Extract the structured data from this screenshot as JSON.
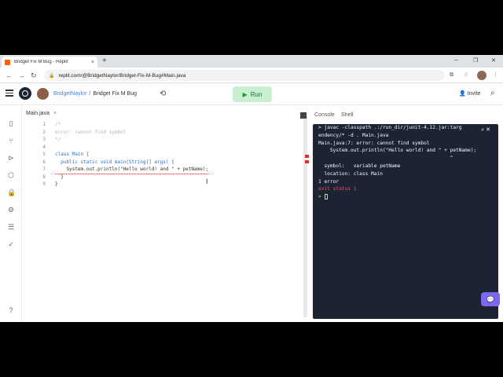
{
  "browser": {
    "tab_title": "Bridget Fix M Bug - Replit",
    "tab_close": "×",
    "new_tab": "+",
    "url": "replit.com/@BridgetNaylor/Bridget-Fix-M-Bug#Main.java",
    "win_minimize": "─",
    "win_restore": "❐",
    "win_close": "✕"
  },
  "header": {
    "user": "BridgetNaylor",
    "separator": "/",
    "repl_name": "Bridget Fix M Bug",
    "run_label": "Run",
    "invite_label": "Invite"
  },
  "editor": {
    "file_tab": "Main.java",
    "file_close": "×",
    "lines": [
      {
        "n": "1",
        "t": "/*"
      },
      {
        "n": "2",
        "t": "error: cannot find symbol"
      },
      {
        "n": "3",
        "t": "*/"
      },
      {
        "n": "4",
        "t": ""
      },
      {
        "n": "5",
        "t": "class Main {"
      },
      {
        "n": "6",
        "t": "  public static void main(String[] args) {"
      },
      {
        "n": "7",
        "t": "    System.out.println(\"Hello world! and \" + petName);"
      },
      {
        "n": "8",
        "t": "  }"
      },
      {
        "n": "9",
        "t": "}"
      }
    ]
  },
  "console": {
    "tab_console": "Console",
    "tab_shell": "Shell",
    "lines": [
      "> javac -classpath .:/run_dir/junit-4.12.jar:targ",
      "endency/* -d . Main.java",
      "Main.java:7: error: cannot find symbol",
      "    System.out.println(\"Hello world! and \" + petName);",
      "                                             ^",
      "  symbol:   variable petName",
      "  location: class Main",
      "1 error"
    ],
    "exit_status": "exit status 1",
    "prompt": ">"
  },
  "colors": {
    "terminal_bg": "#1c2333",
    "run_bg": "#c8f0d0",
    "link": "#3b82f6",
    "error_red": "#f04f5f"
  }
}
